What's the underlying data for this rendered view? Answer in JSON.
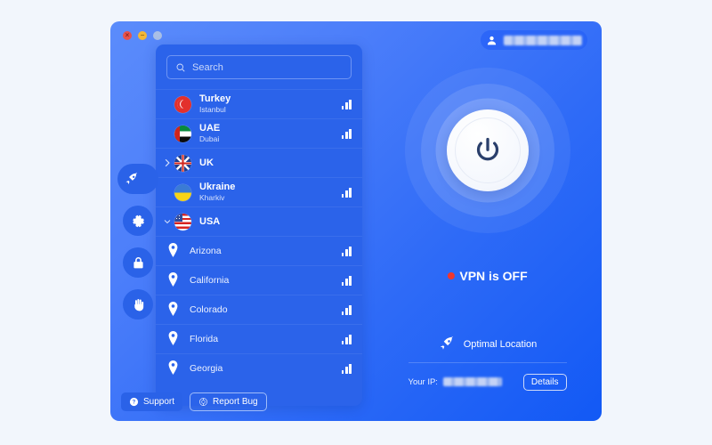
{
  "window": {
    "traffic_lights": [
      {
        "name": "close",
        "glyph": "×",
        "color": "#e8524b"
      },
      {
        "name": "minimize",
        "glyph": "−",
        "color": "#f2b736"
      },
      {
        "name": "zoom",
        "glyph": "",
        "color": "#a9bfe6"
      }
    ],
    "account": {
      "icon": "user-avatar-icon",
      "username_redacted": true
    }
  },
  "rail": {
    "items": [
      {
        "name": "rocket",
        "icon": "rocket-icon",
        "active": true
      },
      {
        "name": "settings",
        "icon": "gear-icon",
        "active": false
      },
      {
        "name": "security",
        "icon": "lock-icon",
        "active": false
      },
      {
        "name": "privacy",
        "icon": "hand-icon",
        "active": false
      }
    ]
  },
  "search": {
    "placeholder": "Search",
    "value": "",
    "icon": "search-icon"
  },
  "server_list": {
    "rows": [
      {
        "type": "country",
        "name": "Turkey",
        "city": "Istanbul",
        "flag": "f-turkey",
        "expandable": false,
        "expanded": false,
        "signal": 3
      },
      {
        "type": "country",
        "name": "UAE",
        "city": "Dubai",
        "flag": "f-uae",
        "expandable": false,
        "expanded": false,
        "signal": 3
      },
      {
        "type": "country",
        "name": "UK",
        "city": "",
        "flag": "f-uk",
        "expandable": true,
        "expanded": false,
        "signal": 0
      },
      {
        "type": "country",
        "name": "Ukraine",
        "city": "Kharkiv",
        "flag": "f-ukraine",
        "expandable": false,
        "expanded": false,
        "signal": 3
      },
      {
        "type": "country",
        "name": "USA",
        "city": "",
        "flag": "f-usa",
        "expandable": true,
        "expanded": true,
        "signal": 0
      },
      {
        "type": "state",
        "name": "Arizona",
        "city": "",
        "flag": "",
        "expandable": false,
        "expanded": false,
        "signal": 3
      },
      {
        "type": "state",
        "name": "California",
        "city": "",
        "flag": "",
        "expandable": false,
        "expanded": false,
        "signal": 3
      },
      {
        "type": "state",
        "name": "Colorado",
        "city": "",
        "flag": "",
        "expandable": false,
        "expanded": false,
        "signal": 3
      },
      {
        "type": "state",
        "name": "Florida",
        "city": "",
        "flag": "",
        "expandable": false,
        "expanded": false,
        "signal": 3
      },
      {
        "type": "state",
        "name": "Georgia",
        "city": "",
        "flag": "",
        "expandable": false,
        "expanded": false,
        "signal": 3
      }
    ]
  },
  "power": {
    "icon": "power-icon",
    "state": "off"
  },
  "status": {
    "label": "VPN is OFF",
    "dot_color": "#f0362e"
  },
  "location_card": {
    "optimal_label": "Optimal Location",
    "optimal_icon": "rocket-icon",
    "ip_label": "Your IP:",
    "ip_redacted": true,
    "details_label": "Details"
  },
  "bottom": {
    "support_label": "Support",
    "support_icon": "question-mark-icon",
    "report_label": "Report Bug",
    "report_icon": "bug-icon"
  },
  "colors": {
    "page_bg": "#f2f6fc",
    "window_blue": "#2f6bf7",
    "panel_blue": "#2b63ea",
    "accent": "#2a62e8",
    "status_red": "#f0362e"
  }
}
